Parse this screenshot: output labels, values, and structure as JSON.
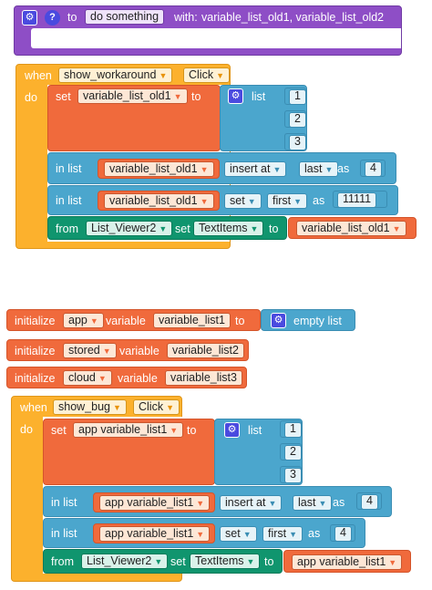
{
  "procedure": {
    "to_label": "to",
    "name": "do something",
    "with_label": "with:",
    "params": "variable_list_old1, variable_list_old2"
  },
  "event1": {
    "when_label": "when",
    "component": "show_workaround",
    "event": "Click",
    "do_label": "do",
    "set_label": "set",
    "set_var": "variable_list_old1",
    "to_label": "to",
    "list_label": "list",
    "list_items": [
      "1",
      "2",
      "3"
    ],
    "inlist1": {
      "in_list": "in list",
      "var": "variable_list_old1",
      "op": "insert at",
      "pos": "last",
      "as": "as",
      "value": "4"
    },
    "inlist2": {
      "in_list": "in list",
      "var": "variable_list_old1",
      "op": "set",
      "pos": "first",
      "as": "as",
      "value": "11111"
    },
    "setter": {
      "from": "from",
      "component": "List_Viewer2",
      "set": "set",
      "prop": "TextItems",
      "to": "to",
      "var": "variable_list_old1"
    }
  },
  "inits": [
    {
      "initialize": "initialize",
      "scope": "app",
      "variable": "variable",
      "name": "variable_list1",
      "to": "to",
      "value": "empty list"
    },
    {
      "initialize": "initialize",
      "scope": "stored",
      "variable": "variable",
      "name": "variable_list2"
    },
    {
      "initialize": "initialize",
      "scope": "cloud",
      "variable": "variable",
      "name": "variable_list3"
    }
  ],
  "event2": {
    "when_label": "when",
    "component": "show_bug",
    "event": "Click",
    "do_label": "do",
    "set_label": "set",
    "set_var": "app variable_list1",
    "to_label": "to",
    "list_label": "list",
    "list_items": [
      "1",
      "2",
      "3"
    ],
    "inlist1": {
      "in_list": "in list",
      "var": "app variable_list1",
      "op": "insert at",
      "pos": "last",
      "as": "as",
      "value": "4"
    },
    "inlist2": {
      "in_list": "in list",
      "var": "app variable_list1",
      "op": "set",
      "pos": "first",
      "as": "as",
      "value": "4"
    },
    "setter": {
      "from": "from",
      "component": "List_Viewer2",
      "set": "set",
      "prop": "TextItems",
      "to": "to",
      "var": "app variable_list1"
    }
  },
  "colors": {
    "procedure": "#8e4ec6",
    "event": "#fcb12d",
    "variable": "#f06a3c",
    "list": "#4ba6cd",
    "component": "#10956e",
    "mutator": "#4a4adf"
  },
  "icons": {
    "gear": "gear-icon",
    "help": "help-icon",
    "dropdown": "dropdown-arrow-icon"
  }
}
